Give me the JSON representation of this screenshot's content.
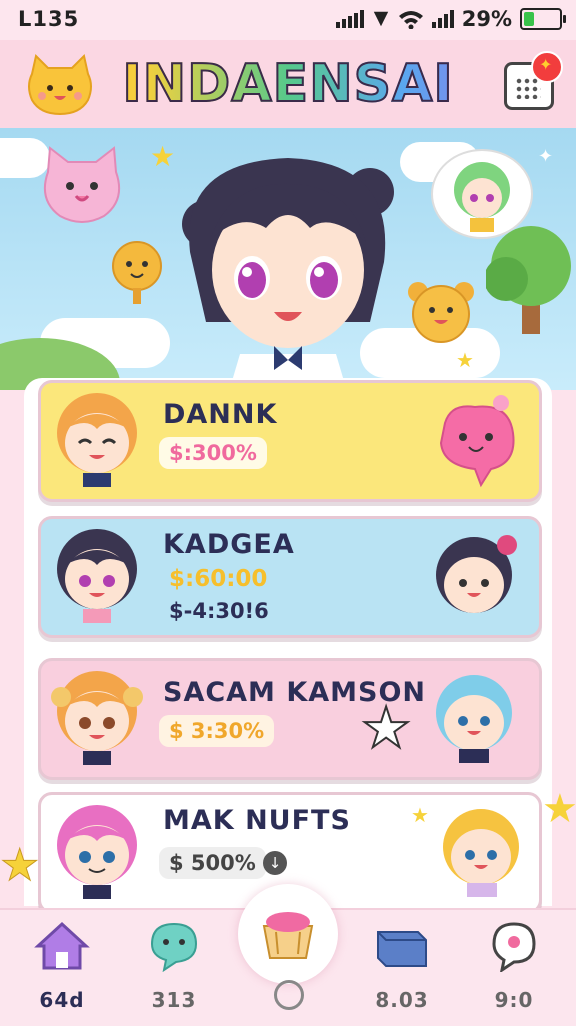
{
  "status_bar": {
    "time": "L135",
    "battery_text": "29%",
    "battery_level": 0.29,
    "battery_color": "#39c24a"
  },
  "header": {
    "title": "INDAENSAI",
    "left_icon": "mascot-icon",
    "right_icon": "menu-grid-icon"
  },
  "hero": {
    "characters": [
      "main-girl",
      "pink-cat",
      "green-hair-girl",
      "bear",
      "dog"
    ]
  },
  "cards": [
    {
      "name": "DANNK",
      "values": [
        "$:300%"
      ],
      "color": "#fbe77b",
      "accent": "#f06a9e"
    },
    {
      "name": "KADGEA",
      "values": [
        "$:60:00",
        "$-4:30!6"
      ],
      "color": "#b9e3f3",
      "accent": "#f6bf2c"
    },
    {
      "name": "SACAM KAMSON",
      "values": [
        "$ 3:30%"
      ],
      "color": "#f9cfde",
      "accent": "#f0a72b"
    },
    {
      "name": "MAK NUFTS",
      "values": [
        "$ 500%"
      ],
      "color": "#ffffff",
      "accent": "#555555"
    }
  ],
  "nav": {
    "items": [
      {
        "label": "64d",
        "icon": "home-icon"
      },
      {
        "label": "313",
        "icon": "chat-bubble-icon"
      },
      {
        "label": "",
        "icon": "gift-basket-icon"
      },
      {
        "label": "8.03",
        "icon": "box-icon"
      },
      {
        "label": "9:0",
        "icon": "speech-icon"
      }
    ]
  }
}
